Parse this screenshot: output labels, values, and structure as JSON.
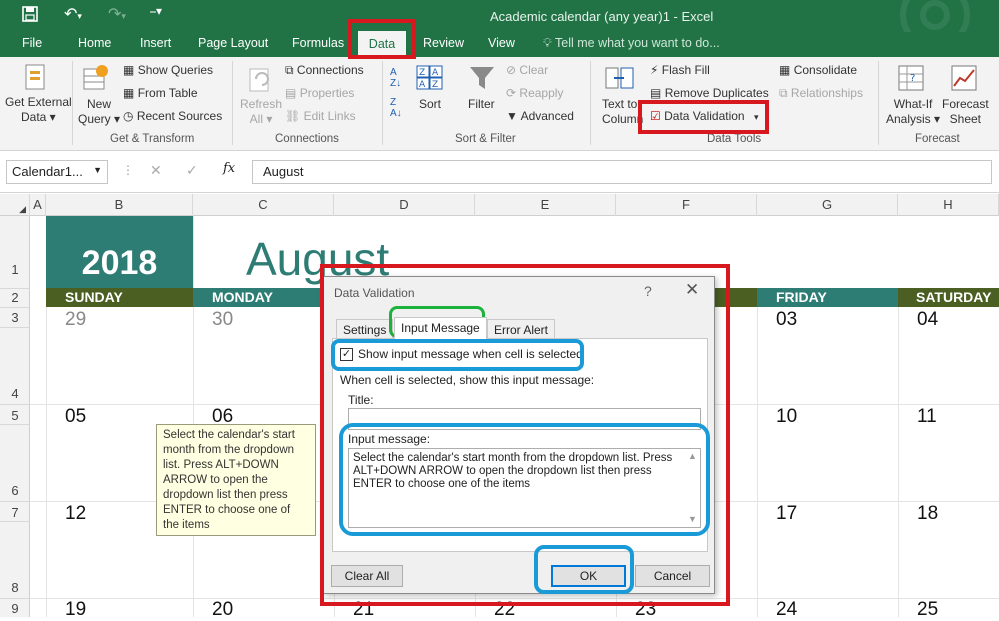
{
  "window": {
    "title": "Academic calendar (any year)1  -  Excel"
  },
  "tabs": [
    "File",
    "Home",
    "Insert",
    "Page Layout",
    "Formulas",
    "Data",
    "Review",
    "View"
  ],
  "tell_me": "Tell me what you want to do...",
  "ribbon": {
    "get_external": [
      "Get External",
      "Data ▾"
    ],
    "new_query": [
      "New",
      "Query ▾"
    ],
    "show_queries": "Show Queries",
    "from_table": "From Table",
    "recent_sources": "Recent Sources",
    "group_get_transform": "Get & Transform",
    "refresh_all": [
      "Refresh",
      "All ▾"
    ],
    "connections": "Connections",
    "properties": "Properties",
    "edit_links": "Edit Links",
    "group_connections": "Connections",
    "sort": "Sort",
    "filter": "Filter",
    "clear": "Clear",
    "reapply": "Reapply",
    "advanced": "Advanced",
    "group_sort_filter": "Sort & Filter",
    "text_to_columns": [
      "Text to",
      "Column"
    ],
    "flash_fill": "Flash Fill",
    "remove_duplicates": "Remove Duplicates",
    "data_validation": "Data Validation",
    "consolidate": "Consolidate",
    "relationships": "Relationships",
    "group_data_tools": "Data Tools",
    "what_if": [
      "What-If",
      "Analysis ▾"
    ],
    "forecast_sheet": [
      "Forecast",
      "Sheet"
    ],
    "group_forecast": "Forecast"
  },
  "formula_bar": {
    "name_box": "Calendar1...",
    "formula": "August"
  },
  "columns": [
    "A",
    "B",
    "C",
    "D",
    "E",
    "F",
    "G",
    "H"
  ],
  "rows": [
    "1",
    "2",
    "3",
    "4",
    "5",
    "6",
    "7",
    "8",
    "9"
  ],
  "calendar": {
    "year": "2018",
    "month": "August",
    "day_headers": [
      "SUNDAY",
      "MONDAY",
      "FRIDAY",
      "SATURDAY"
    ],
    "week1": [
      "29",
      "30",
      "03",
      "04"
    ],
    "week2": [
      "05",
      "06",
      "10",
      "11"
    ],
    "week3": [
      "12",
      "17",
      "18"
    ],
    "week4": [
      "19",
      "20",
      "21",
      "22",
      "23",
      "24",
      "25"
    ]
  },
  "tooltip": "Select the calendar's start month from the dropdown list. Press ALT+DOWN ARROW to open the dropdown list then press ENTER to choose one of the items",
  "dialog": {
    "title": "Data Validation",
    "help": "?",
    "close": "✕",
    "tabs": [
      "Settings",
      "Input Message",
      "Error Alert"
    ],
    "show_checkbox_label": "Show input message when cell is selected",
    "show_checked": true,
    "when_label": "When cell is selected, show this input message:",
    "title_label": "Title:",
    "title_value": "",
    "message_label": "Input message:",
    "message_value": "Select the calendar's start month from the dropdown list. Press ALT+DOWN ARROW to open the dropdown list then press ENTER to choose one of the items",
    "clear_all": "Clear All",
    "ok": "OK",
    "cancel": "Cancel"
  },
  "colors": {
    "excel_green": "#217346",
    "calendar_teal": "#2e7d74",
    "weekday_dark": "#4b5f23",
    "annotation_red": "#d7191f",
    "annotation_green": "#1db23b",
    "annotation_blue": "#1a9ad6"
  }
}
